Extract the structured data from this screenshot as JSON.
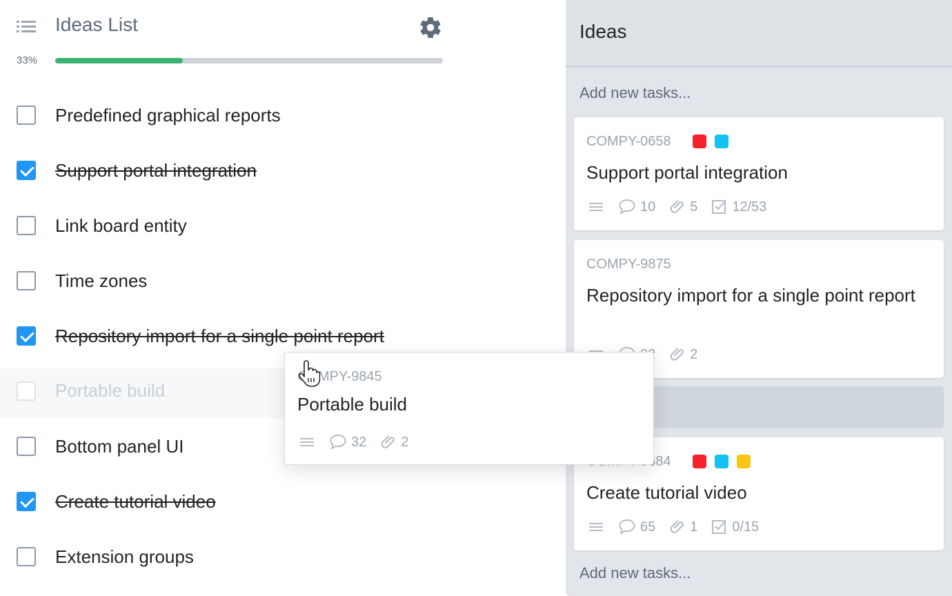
{
  "list": {
    "title": "Ideas List",
    "progress_label": "33%",
    "progress": 0.33,
    "items": [
      {
        "label": "Predefined graphical reports",
        "done": false
      },
      {
        "label": "Support portal integration",
        "done": true
      },
      {
        "label": "Link board entity",
        "done": false
      },
      {
        "label": "Time zones",
        "done": false
      },
      {
        "label": "Repository import for a single point report",
        "done": true
      },
      {
        "label": "Portable build",
        "done": false,
        "dragging": true
      },
      {
        "label": "Bottom panel UI",
        "done": false
      },
      {
        "label": "Create tutorial video",
        "done": true
      },
      {
        "label": "Extension groups",
        "done": false
      }
    ]
  },
  "board": {
    "title": "Ideas",
    "add_task_label": "Add new tasks...",
    "cards": [
      {
        "code": "COMPY-0658",
        "title": "Support portal integration",
        "tags": [
          "#f5222d",
          "#13c2f0"
        ],
        "comments": "10",
        "attachments": "5",
        "checklist": "12/53"
      },
      {
        "code": "COMPY-9875",
        "title": "Repository import for a single point report",
        "tags": [],
        "comments": "32",
        "attachments": "2",
        "checklist": null
      },
      {
        "code": "COMPY-0684",
        "title": "Create tutorial video",
        "tags": [
          "#f5222d",
          "#13c2f0",
          "#fac515"
        ],
        "comments": "65",
        "attachments": "1",
        "checklist": "0/15"
      }
    ]
  },
  "dragged_card": {
    "code": "COMPY-9845",
    "title": "Portable build",
    "comments": "32",
    "attachments": "2"
  },
  "colors": {
    "progress_fill": "#3bb273",
    "checkbox_checked": "#2196f3"
  }
}
